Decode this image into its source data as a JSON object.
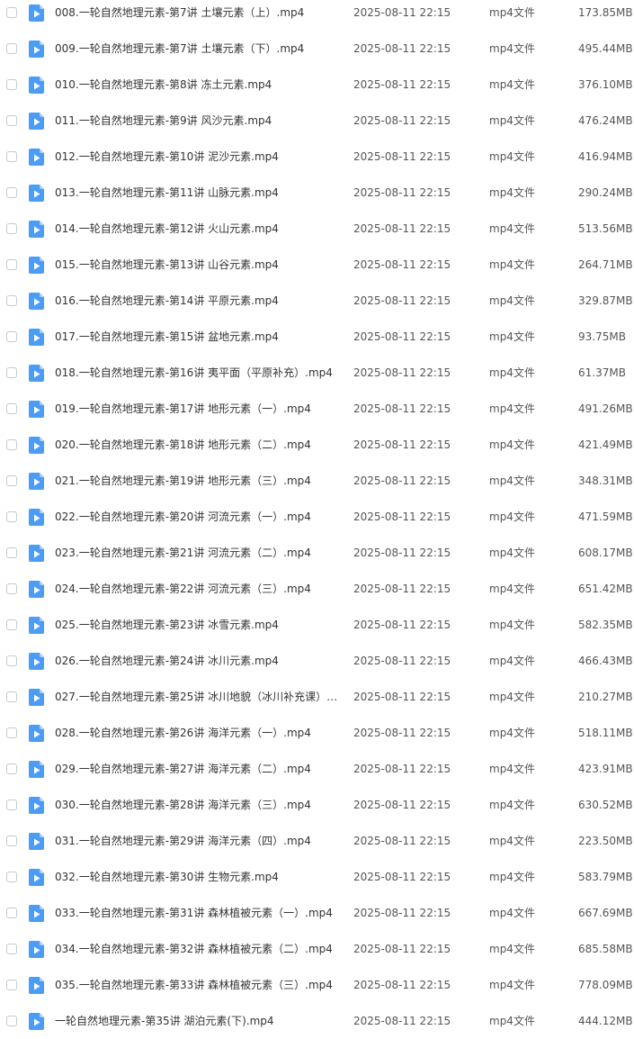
{
  "icon": "video-file-icon",
  "colors": {
    "icon_blue": "#4b9cf5",
    "icon_fold": "#a9cefb",
    "text": "#333333"
  },
  "files": [
    {
      "name": "008.一轮自然地理元素-第7讲 土壤元素（上）.mp4",
      "date": "2025-08-11 22:15",
      "type": "mp4文件",
      "size": "173.85MB"
    },
    {
      "name": "009.一轮自然地理元素-第7讲 土壤元素（下）.mp4",
      "date": "2025-08-11 22:15",
      "type": "mp4文件",
      "size": "495.44MB"
    },
    {
      "name": "010.一轮自然地理元素-第8讲 冻土元素.mp4",
      "date": "2025-08-11 22:15",
      "type": "mp4文件",
      "size": "376.10MB"
    },
    {
      "name": "011.一轮自然地理元素-第9讲 风沙元素.mp4",
      "date": "2025-08-11 22:15",
      "type": "mp4文件",
      "size": "476.24MB"
    },
    {
      "name": "012.一轮自然地理元素-第10讲 泥沙元素.mp4",
      "date": "2025-08-11 22:15",
      "type": "mp4文件",
      "size": "416.94MB"
    },
    {
      "name": "013.一轮自然地理元素-第11讲 山脉元素.mp4",
      "date": "2025-08-11 22:15",
      "type": "mp4文件",
      "size": "290.24MB"
    },
    {
      "name": "014.一轮自然地理元素-第12讲 火山元素.mp4",
      "date": "2025-08-11 22:15",
      "type": "mp4文件",
      "size": "513.56MB"
    },
    {
      "name": "015.一轮自然地理元素-第13讲 山谷元素.mp4",
      "date": "2025-08-11 22:15",
      "type": "mp4文件",
      "size": "264.71MB"
    },
    {
      "name": "016.一轮自然地理元素-第14讲 平原元素.mp4",
      "date": "2025-08-11 22:15",
      "type": "mp4文件",
      "size": "329.87MB"
    },
    {
      "name": "017.一轮自然地理元素-第15讲 盆地元素.mp4",
      "date": "2025-08-11 22:15",
      "type": "mp4文件",
      "size": "93.75MB"
    },
    {
      "name": "018.一轮自然地理元素-第16讲 夷平面（平原补充）.mp4",
      "date": "2025-08-11 22:15",
      "type": "mp4文件",
      "size": "61.37MB"
    },
    {
      "name": "019.一轮自然地理元素-第17讲 地形元素（一）.mp4",
      "date": "2025-08-11 22:15",
      "type": "mp4文件",
      "size": "491.26MB"
    },
    {
      "name": "020.一轮自然地理元素-第18讲 地形元素（二）.mp4",
      "date": "2025-08-11 22:15",
      "type": "mp4文件",
      "size": "421.49MB"
    },
    {
      "name": "021.一轮自然地理元素-第19讲 地形元素（三）.mp4",
      "date": "2025-08-11 22:15",
      "type": "mp4文件",
      "size": "348.31MB"
    },
    {
      "name": "022.一轮自然地理元素-第20讲 河流元素（一）.mp4",
      "date": "2025-08-11 22:15",
      "type": "mp4文件",
      "size": "471.59MB"
    },
    {
      "name": "023.一轮自然地理元素-第21讲 河流元素（二）.mp4",
      "date": "2025-08-11 22:15",
      "type": "mp4文件",
      "size": "608.17MB"
    },
    {
      "name": "024.一轮自然地理元素-第22讲 河流元素（三）.mp4",
      "date": "2025-08-11 22:15",
      "type": "mp4文件",
      "size": "651.42MB"
    },
    {
      "name": "025.一轮自然地理元素-第23讲 冰雪元素.mp4",
      "date": "2025-08-11 22:15",
      "type": "mp4文件",
      "size": "582.35MB"
    },
    {
      "name": "026.一轮自然地理元素-第24讲 冰川元素.mp4",
      "date": "2025-08-11 22:15",
      "type": "mp4文件",
      "size": "466.43MB"
    },
    {
      "name": "027.一轮自然地理元素-第25讲 冰川地貌（冰川补充课）....",
      "date": "2025-08-11 22:15",
      "type": "mp4文件",
      "size": "210.27MB"
    },
    {
      "name": "028.一轮自然地理元素-第26讲 海洋元素（一）.mp4",
      "date": "2025-08-11 22:15",
      "type": "mp4文件",
      "size": "518.11MB"
    },
    {
      "name": "029.一轮自然地理元素-第27讲 海洋元素（二）.mp4",
      "date": "2025-08-11 22:15",
      "type": "mp4文件",
      "size": "423.91MB"
    },
    {
      "name": "030.一轮自然地理元素-第28讲 海洋元素（三）.mp4",
      "date": "2025-08-11 22:15",
      "type": "mp4文件",
      "size": "630.52MB"
    },
    {
      "name": "031.一轮自然地理元素-第29讲 海洋元素（四）.mp4",
      "date": "2025-08-11 22:15",
      "type": "mp4文件",
      "size": "223.50MB"
    },
    {
      "name": "032.一轮自然地理元素-第30讲 生物元素.mp4",
      "date": "2025-08-11 22:15",
      "type": "mp4文件",
      "size": "583.79MB"
    },
    {
      "name": "033.一轮自然地理元素-第31讲 森林植被元素（一）.mp4",
      "date": "2025-08-11 22:15",
      "type": "mp4文件",
      "size": "667.69MB"
    },
    {
      "name": "034.一轮自然地理元素-第32讲 森林植被元素（二）.mp4",
      "date": "2025-08-11 22:15",
      "type": "mp4文件",
      "size": "685.58MB"
    },
    {
      "name": "035.一轮自然地理元素-第33讲 森林植被元素（三）.mp4",
      "date": "2025-08-11 22:15",
      "type": "mp4文件",
      "size": "778.09MB"
    },
    {
      "name": "一轮自然地理元素-第35讲 湖泊元素(下).mp4",
      "date": "2025-08-11 22:15",
      "type": "mp4文件",
      "size": "444.12MB"
    }
  ]
}
